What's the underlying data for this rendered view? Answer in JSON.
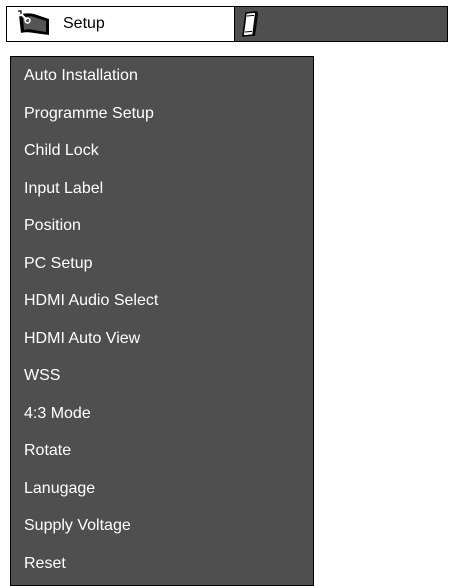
{
  "header": {
    "setup_tab_label": "Setup",
    "setup_tab_icon": "wrench-tv-icon",
    "next_tab_icon": "notepad-icon"
  },
  "menu": {
    "items": [
      {
        "label": "Auto Installation"
      },
      {
        "label": "Programme Setup"
      },
      {
        "label": "Child Lock"
      },
      {
        "label": "Input Label"
      },
      {
        "label": "Position"
      },
      {
        "label": "PC Setup"
      },
      {
        "label": "HDMI Audio Select"
      },
      {
        "label": "HDMI Auto View"
      },
      {
        "label": "WSS"
      },
      {
        "label": "4:3 Mode"
      },
      {
        "label": "Rotate"
      },
      {
        "label": "Lanugage"
      },
      {
        "label": "Supply Voltage"
      },
      {
        "label": "Reset"
      }
    ]
  },
  "colors": {
    "menu_background": "#4f4f4f",
    "tab_background": "#505050",
    "active_tab_background": "#ffffff",
    "text_light": "#ffffff",
    "text_dark": "#000000"
  }
}
